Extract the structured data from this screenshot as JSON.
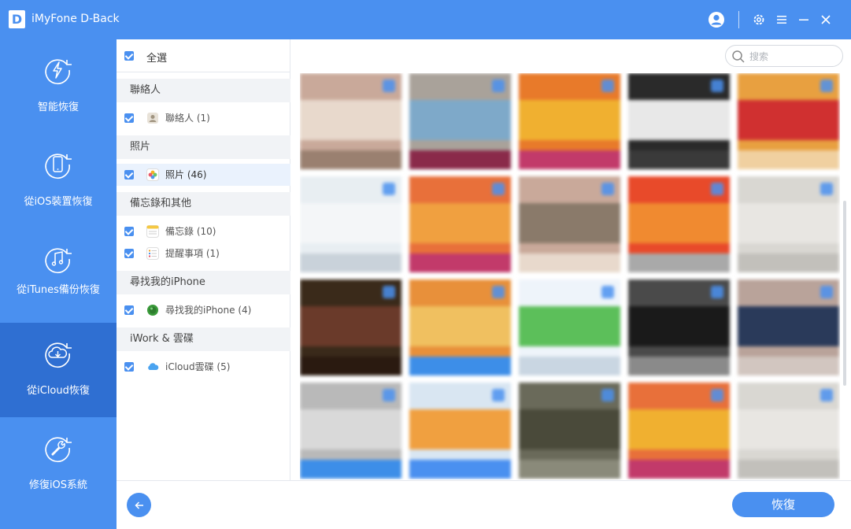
{
  "app": {
    "logo": "D",
    "title": "iMyFone D-Back"
  },
  "titlebar": {
    "icons": [
      "user-icon",
      "gear-icon",
      "menu-icon",
      "minimize-icon",
      "close-icon"
    ]
  },
  "sidebar": {
    "items": [
      {
        "label": "智能恢復",
        "icon": "lightning-icon",
        "active": false
      },
      {
        "label": "從iOS裝置恢復",
        "icon": "phone-icon",
        "active": false
      },
      {
        "label": "從iTunes備份恢復",
        "icon": "music-icon",
        "active": false
      },
      {
        "label": "從iCloud恢復",
        "icon": "cloud-download-icon",
        "active": true
      },
      {
        "label": "修復iOS系統",
        "icon": "wrench-icon",
        "active": false
      }
    ]
  },
  "categories": {
    "select_all": "全選",
    "groups": [
      {
        "header": "聯絡人",
        "items": [
          {
            "label": "聯絡人 (1)",
            "icon": "contacts-icon"
          }
        ]
      },
      {
        "header": "照片",
        "items": [
          {
            "label": "照片 (46)",
            "icon": "photos-icon"
          }
        ]
      },
      {
        "header": "備忘錄和其他",
        "items": [
          {
            "label": "備忘錄 (10)",
            "icon": "notes-icon"
          },
          {
            "label": "提醒事項 (1)",
            "icon": "reminders-icon"
          }
        ]
      },
      {
        "header": "尋找我的iPhone",
        "items": [
          {
            "label": "尋找我的iPhone (4)",
            "icon": "find-iphone-icon"
          }
        ]
      },
      {
        "header": "iWork & 雲碟",
        "items": [
          {
            "label": "iCloud雲碟 (5)",
            "icon": "icloud-icon"
          }
        ]
      }
    ]
  },
  "search": {
    "placeholder": "搜索"
  },
  "footer": {
    "recover_label": "恢復"
  },
  "colors": {
    "accent": "#4a90f0",
    "sidebar_active": "#2f6fd2"
  }
}
